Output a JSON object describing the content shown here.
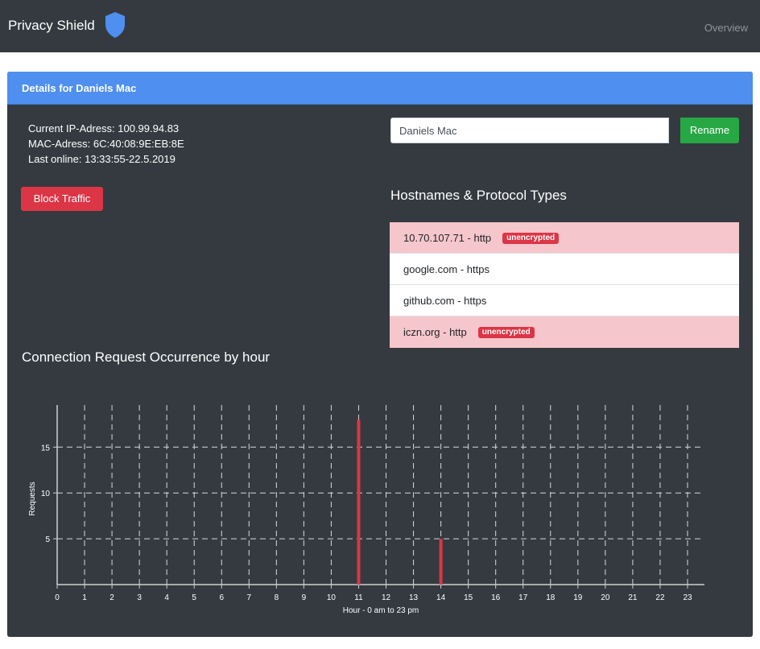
{
  "navbar": {
    "brand": "Privacy Shield",
    "brand_icon": "shield-icon",
    "overview_link": "Overview"
  },
  "card": {
    "header": "Details for Daniels Mac",
    "info": {
      "ip": "Current IP-Adress: 100.99.94.83",
      "mac": "MAC-Adress: 6C:40:08:9E:EB:8E",
      "last_online": "Last online: 13:33:55-22.5.2019"
    },
    "block_button": "Block Traffic",
    "rename": {
      "value": "Daniels Mac",
      "button": "Rename"
    },
    "hostnames_title": "Hostnames & Protocol Types",
    "hosts": [
      {
        "label": "10.70.107.71 - http",
        "badge": "unencrypted"
      },
      {
        "label": "google.com - https",
        "badge": ""
      },
      {
        "label": "github.com - https",
        "badge": ""
      },
      {
        "label": "iczn.org - http",
        "badge": "unencrypted"
      }
    ],
    "chart_title": "Connection Request Occurrence by hour"
  },
  "colors": {
    "navbar": "#343a40",
    "card_header": "#4e8ff0",
    "danger": "#dc3545",
    "success": "#28a745",
    "unencrypted_row": "#f5c6cb"
  },
  "chart_data": {
    "type": "bar",
    "title": "Connection Request Occurrence by hour",
    "xlabel": "Hour - 0 am to 23 pm",
    "ylabel": "Requests",
    "x": [
      0,
      1,
      2,
      3,
      4,
      5,
      6,
      7,
      8,
      9,
      10,
      11,
      12,
      13,
      14,
      15,
      16,
      17,
      18,
      19,
      20,
      21,
      22,
      23
    ],
    "values": [
      0,
      0,
      0,
      0,
      0,
      0,
      0,
      0,
      0,
      0,
      0,
      18,
      0,
      0,
      5,
      0,
      0,
      0,
      0,
      0,
      0,
      0,
      0,
      0
    ],
    "ylim": [
      0,
      20
    ],
    "yticks": [
      5,
      10,
      15
    ],
    "grid": true,
    "bar_color": "#dc3545"
  }
}
